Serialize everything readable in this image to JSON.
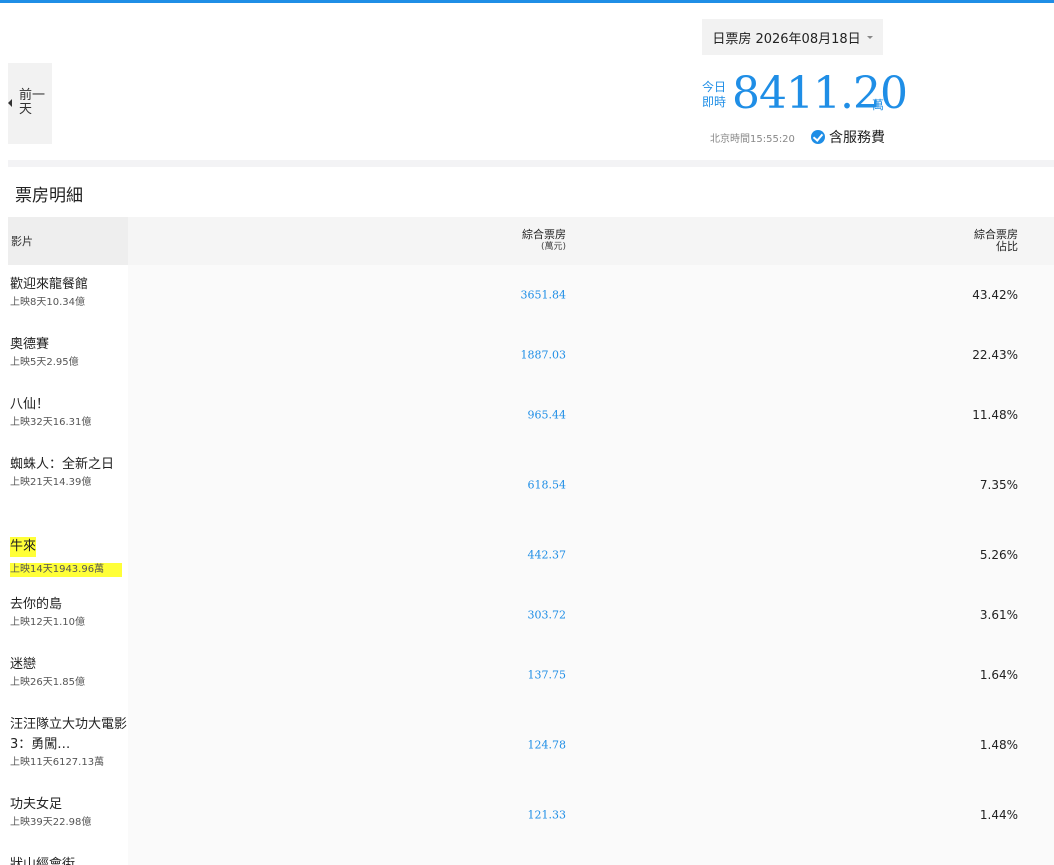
{
  "nav": {
    "prev_day": "前一天"
  },
  "date_select": {
    "label": "日票房 2026年08月18日"
  },
  "today": {
    "label": "今日即時",
    "value": "8411.20",
    "unit": "萬"
  },
  "beijing_time": "北京時間15:55:20",
  "fee_label": "含服務費",
  "section_title": "票房明細",
  "table": {
    "headers": {
      "film": "影片",
      "box": "綜合票房",
      "box_unit": "(萬元)",
      "share": "綜合票房",
      "share_sub": "佔比"
    },
    "rows": [
      {
        "name": "歡迎來龍餐館",
        "info": "上映8天10.34億",
        "box": "3651.84",
        "share": "43.42%"
      },
      {
        "name": "奧德賽",
        "info": "上映5天2.95億",
        "box": "1887.03",
        "share": "22.43%"
      },
      {
        "name": "八仙！",
        "info": "上映32天16.31億",
        "box": "965.44",
        "share": "11.48%"
      },
      {
        "name": "蜘蛛人：全新之日",
        "info": "上映21天14.39億",
        "box": "618.54",
        "share": "7.35%"
      },
      {
        "name": "牛來",
        "info": "上映14天1943.96萬",
        "box": "442.37",
        "share": "5.26%"
      },
      {
        "name": "去你的島",
        "info": "上映12天1.10億",
        "box": "303.72",
        "share": "3.61%"
      },
      {
        "name": "迷戀",
        "info": "上映26天1.85億",
        "box": "137.75",
        "share": "1.64%"
      },
      {
        "name": "汪汪隊立大功大電影3：勇闖…",
        "info": "上映11天6127.13萬",
        "box": "124.78",
        "share": "1.48%"
      },
      {
        "name": "功夫女足",
        "info": "上映39天22.98億",
        "box": "121.33",
        "share": "1.44%"
      },
      {
        "name": "狀山經會街",
        "info": "",
        "box": "",
        "share": ""
      }
    ]
  },
  "colors": {
    "accent": "#1f8ee6",
    "highlight": "#ffff38"
  }
}
